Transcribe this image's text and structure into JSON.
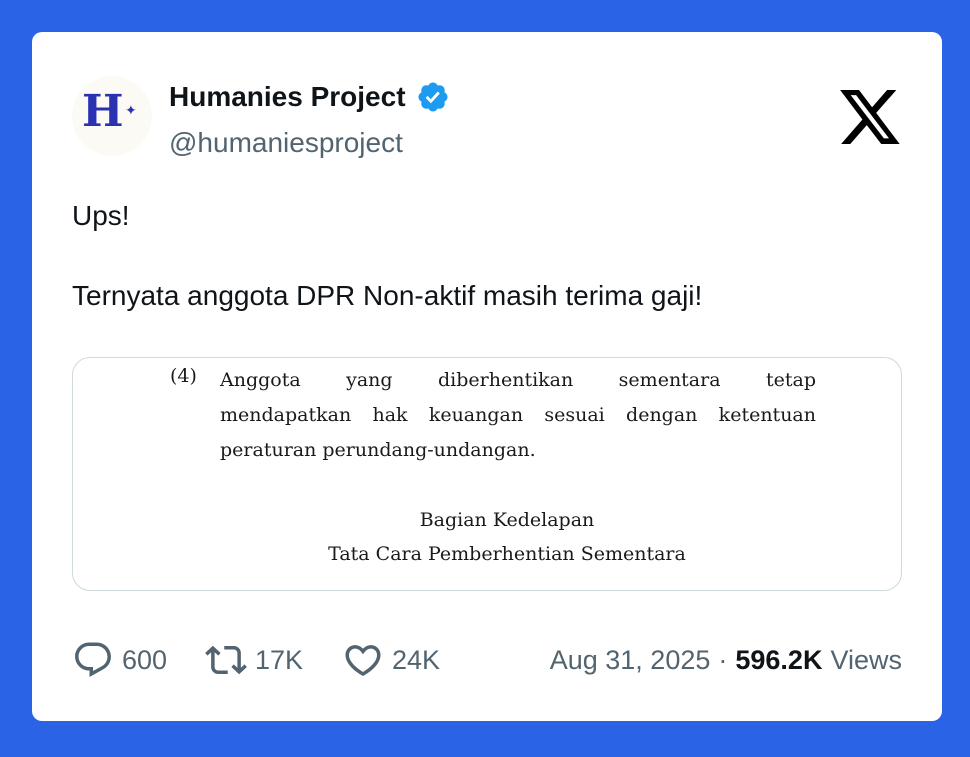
{
  "author": {
    "display_name": "Humanies Project",
    "handle": "@humaniesproject",
    "verified": true,
    "avatar_letter": "H",
    "avatar_color": "#2b32b2"
  },
  "platform_icon": "x-logo-icon",
  "tweet": {
    "lines": [
      "Ups!",
      "",
      "Ternyata anggota DPR Non-aktif masih terima gaji!"
    ]
  },
  "media": {
    "clause_number": "(4)",
    "clause_lines": [
      "Anggota yang diberhentikan sementara tetap",
      "mendapatkan hak keuangan sesuai dengan ketentuan",
      "peraturan perundang-undangan."
    ],
    "section_title": "Bagian Kedelapan",
    "section_subtitle": "Tata Cara Pemberhentian Sementara"
  },
  "actions": {
    "replies": "600",
    "retweets": "17K",
    "likes": "24K"
  },
  "meta": {
    "date": "Aug 31, 2025",
    "separator": "·",
    "views_count": "596.2K",
    "views_label": "Views"
  },
  "colors": {
    "background": "#2b63e6",
    "card": "#ffffff",
    "verified_badge": "#1d9bf0",
    "secondary_text": "#536471",
    "primary_text": "#0f1419"
  }
}
